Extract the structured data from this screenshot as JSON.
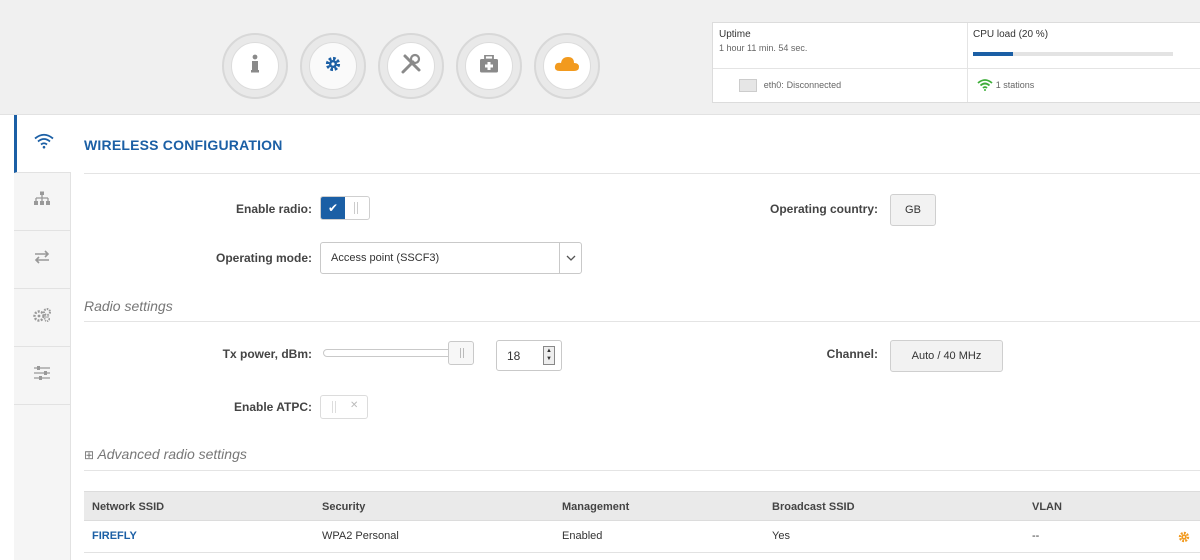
{
  "header": {
    "nav": [
      {
        "name": "info-icon"
      },
      {
        "name": "gear-icon"
      },
      {
        "name": "tools-icon"
      },
      {
        "name": "medkit-icon"
      },
      {
        "name": "cloud-icon"
      }
    ],
    "status": {
      "uptime_label": "Uptime",
      "uptime_value": "1 hour 11 min. 54 sec.",
      "cpu_label": "CPU load (20 %)",
      "cpu_load_percent": 20,
      "eth_label": "eth0:",
      "eth_value": "Disconnected",
      "stations_value": "1 stations"
    }
  },
  "sidebar": {
    "items": [
      {
        "icon": "wifi-icon"
      },
      {
        "icon": "network-icon"
      },
      {
        "icon": "transfer-icon"
      },
      {
        "icon": "gears-icon"
      },
      {
        "icon": "sliders-icon"
      }
    ]
  },
  "page": {
    "title": "WIRELESS CONFIGURATION",
    "enable_radio_label": "Enable radio:",
    "operating_mode_label": "Operating mode:",
    "operating_mode_value": "Access point (SSCF3)",
    "operating_country_label": "Operating country:",
    "operating_country_value": "GB",
    "radio_settings_title": "Radio settings",
    "tx_power_label": "Tx power, dBm:",
    "tx_power_value": "18",
    "channel_label": "Channel:",
    "channel_value": "Auto / 40 MHz",
    "enable_atpc_label": "Enable ATPC:",
    "advanced_title": "Advanced radio settings",
    "advanced_expand": "⊞"
  },
  "table": {
    "headers": [
      "Network SSID",
      "Security",
      "Management",
      "Broadcast SSID",
      "VLAN"
    ],
    "rows": [
      {
        "ssid": "FIREFLY",
        "security": "WPA2 Personal",
        "management": "Enabled",
        "broadcast": "Yes",
        "vlan": "--"
      }
    ]
  },
  "colors": {
    "accent": "#1b5fa5",
    "orange": "#f29a1e",
    "green": "#3fae3a"
  }
}
